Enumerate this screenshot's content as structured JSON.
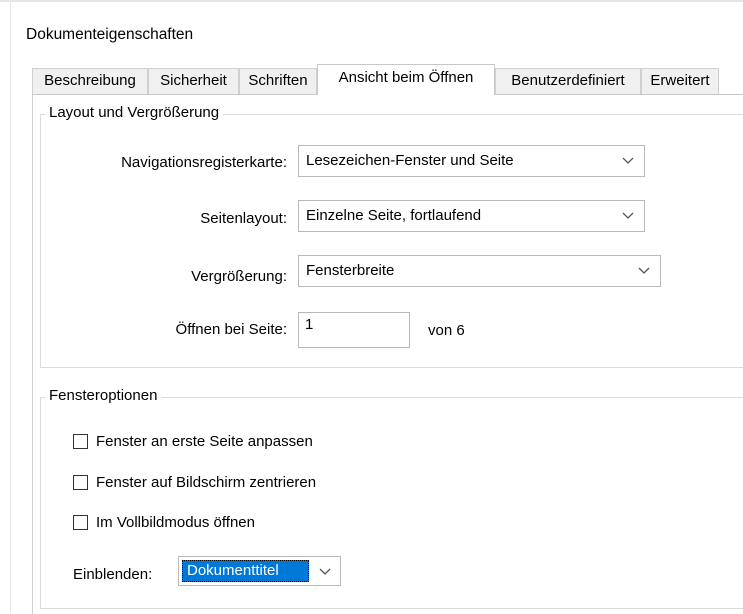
{
  "window": {
    "title": "Dokumenteigenschaften"
  },
  "tabs": [
    {
      "label": "Beschreibung"
    },
    {
      "label": "Sicherheit"
    },
    {
      "label": "Schriften"
    },
    {
      "label": "Ansicht beim Öffnen"
    },
    {
      "label": "Benutzerdefiniert"
    },
    {
      "label": "Erweitert"
    }
  ],
  "layout_group": {
    "legend": "Layout und Vergrößerung",
    "nav_label": "Navigationsregisterkarte:",
    "nav_value": "Lesezeichen-Fenster und Seite",
    "page_layout_label": "Seitenlayout:",
    "page_layout_value": "Einzelne Seite, fortlaufend",
    "zoom_label": "Vergrößerung:",
    "zoom_value": "Fensterbreite",
    "open_page_label": "Öffnen bei Seite:",
    "open_page_value": "1",
    "of_pages": "von 6"
  },
  "window_group": {
    "legend": "Fensteroptionen",
    "options": [
      {
        "label": "Fenster an erste Seite anpassen",
        "checked": false
      },
      {
        "label": "Fenster auf Bildschirm zentrieren",
        "checked": false
      },
      {
        "label": "Im Vollbildmodus öffnen",
        "checked": false
      }
    ],
    "show_label": "Einblenden:",
    "show_value": "Dokumenttitel"
  },
  "icons": {
    "dropdown": "chevron-down-icon"
  },
  "colors": {
    "selection": "#0078d7"
  }
}
